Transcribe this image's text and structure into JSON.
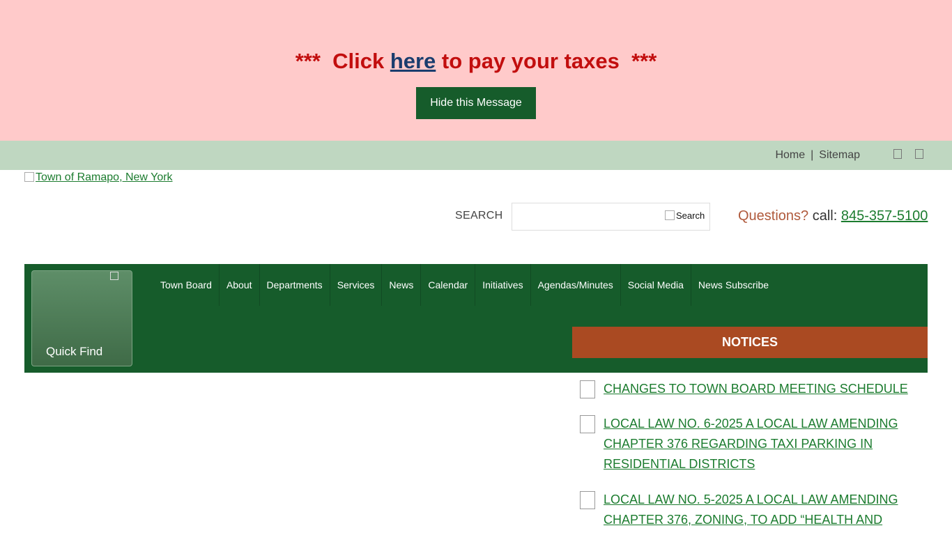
{
  "alert": {
    "text_before": "***  Click ",
    "link_text": "here",
    "text_after": " to pay your taxes  ***",
    "button_label": "Hide this Message"
  },
  "utility": {
    "home_label": "Home",
    "separator": "|",
    "sitemap_label": "Sitemap",
    "social_icons": [
      "social-icon",
      "social-icon"
    ]
  },
  "logo": {
    "alt": "Town of Ramapo, New York"
  },
  "search": {
    "label": "SEARCH",
    "value": "",
    "button_alt": "Search"
  },
  "contact": {
    "question": "Questions?",
    "call_label": " call: ",
    "phone": "845-357-5100"
  },
  "quickfind": {
    "label": "Quick Find"
  },
  "nav": {
    "items": [
      {
        "label": "Town Board"
      },
      {
        "label": "About"
      },
      {
        "label": "Departments"
      },
      {
        "label": "Services"
      },
      {
        "label": "News"
      },
      {
        "label": "Calendar"
      },
      {
        "label": "Initiatives"
      },
      {
        "label": "Agendas/Minutes"
      },
      {
        "label": "Social Media"
      },
      {
        "label": "News Subscribe"
      }
    ]
  },
  "notices": {
    "heading": "NOTICES",
    "items": [
      {
        "title": "CHANGES TO TOWN BOARD MEETING SCHEDULE"
      },
      {
        "title": "LOCAL LAW NO. 6-2025 A LOCAL LAW AMENDING CHAPTER 376 REGARDING TAXI PARKING IN RESIDENTIAL DISTRICTS"
      },
      {
        "title": "LOCAL LAW NO. 5-2025 A LOCAL LAW AMENDING CHAPTER 376, ZONING, TO ADD “HEALTH AND"
      }
    ]
  },
  "colors": {
    "alert_bg": "#ffcaca",
    "alert_text": "#c20e0e",
    "brand_green": "#165c2b",
    "util_bar": "#bfd7c1",
    "notices_orange": "#aa4a22",
    "link_green": "#1c7c2f"
  }
}
